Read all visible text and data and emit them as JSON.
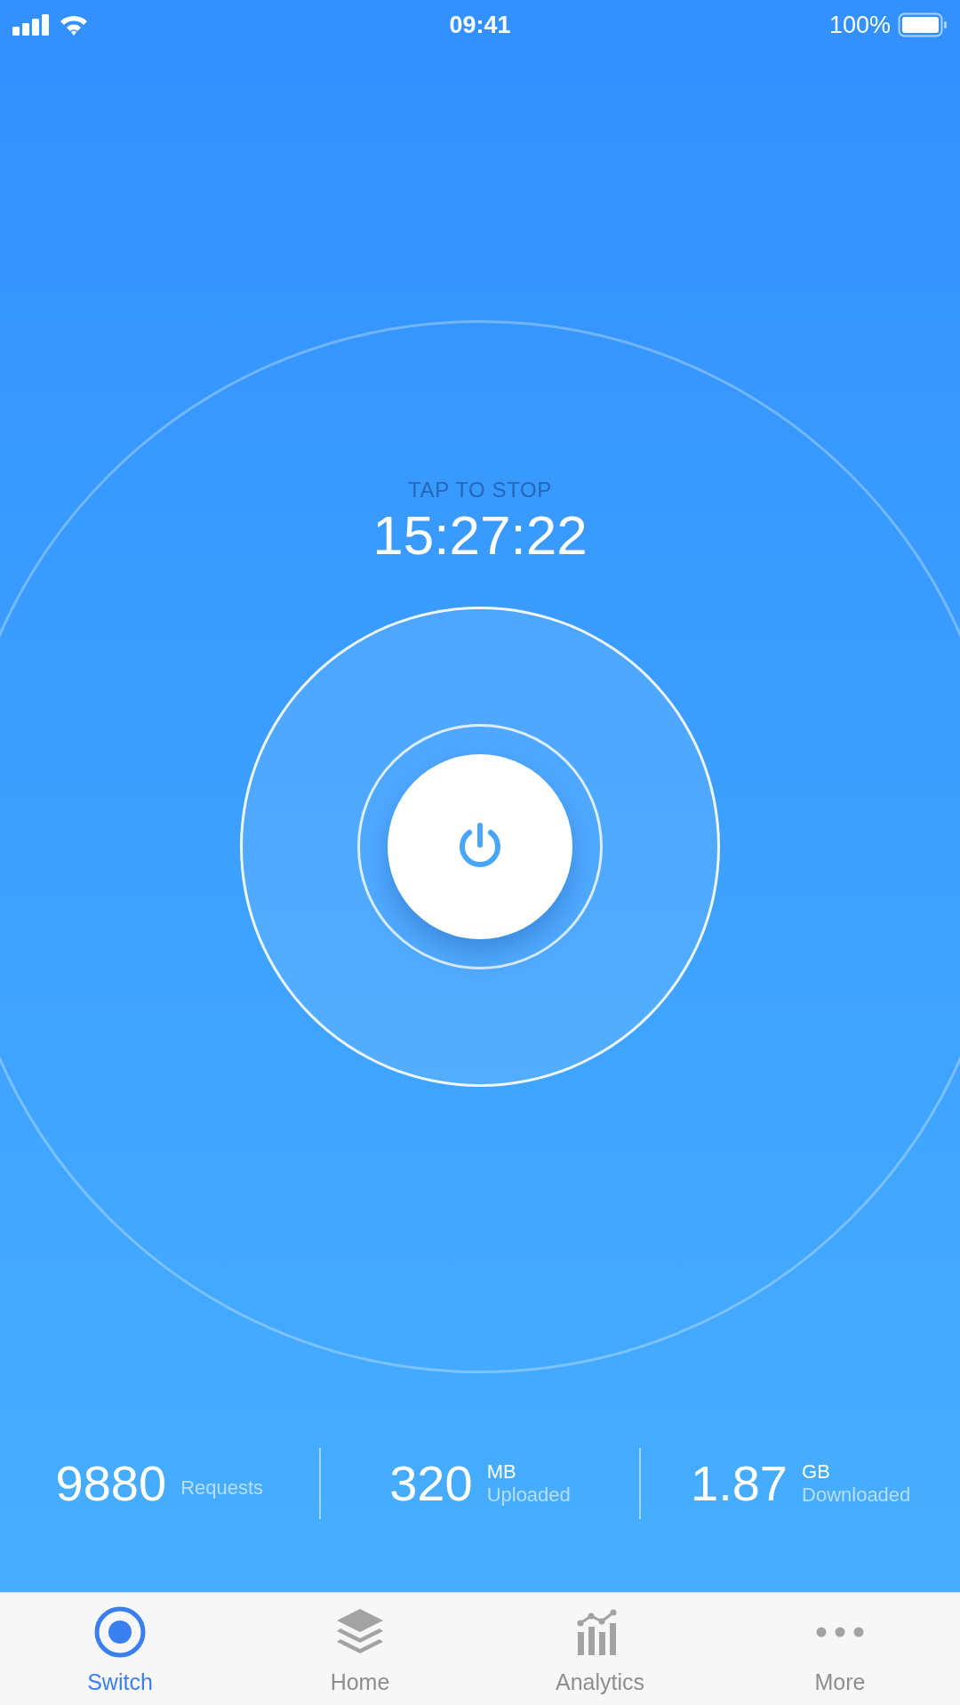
{
  "status_bar": {
    "time": "09:41",
    "battery": "100%"
  },
  "session": {
    "hint": "TAP TO STOP",
    "timer": "15:27:22"
  },
  "stats": [
    {
      "value": "9880",
      "label": "Requests"
    },
    {
      "value": "320",
      "unit": "MB",
      "label": "Uploaded"
    },
    {
      "value": "1.87",
      "unit": "GB",
      "label": "Downloaded"
    }
  ],
  "tabs": [
    {
      "kind": "switch",
      "label": "Switch",
      "selected": true
    },
    {
      "kind": "home",
      "label": "Home",
      "selected": false
    },
    {
      "kind": "analytics",
      "label": "Analytics",
      "selected": false
    },
    {
      "kind": "more",
      "label": "More",
      "selected": false
    }
  ]
}
